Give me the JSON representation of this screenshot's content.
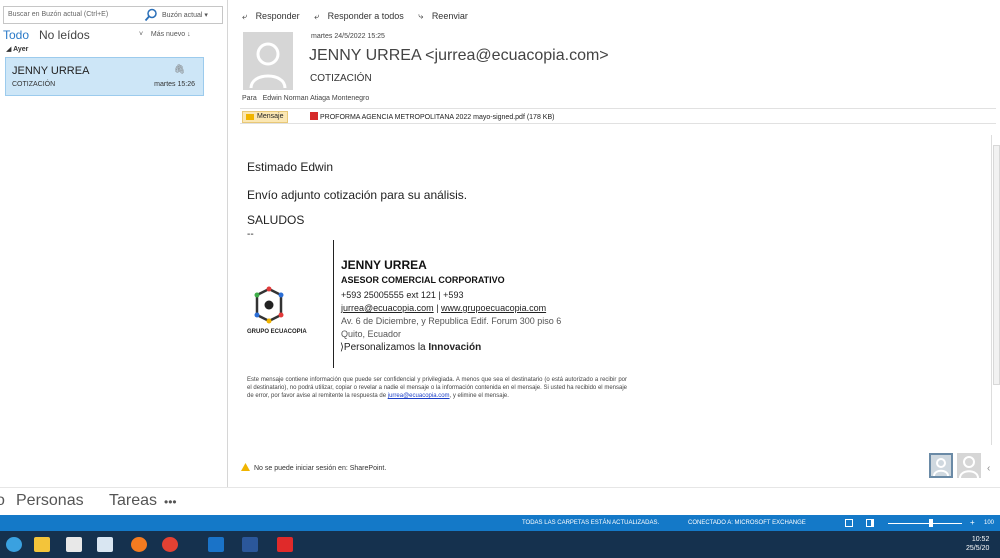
{
  "search": {
    "placeholder": "Buscar en Buzón actual (Ctrl+E)",
    "scope": "Buzón actual"
  },
  "filters": {
    "all": "Todo",
    "unread": "No leídos",
    "sort": "Más nuevo"
  },
  "list": {
    "group": "Ayer",
    "items": [
      {
        "from": "JENNY URREA",
        "subject": "COTIZACIÓN",
        "time": "martes 15:26"
      }
    ]
  },
  "actions": {
    "reply": "Responder",
    "reply_all": "Responder a todos",
    "forward": "Reenviar"
  },
  "message": {
    "date": "martes 24/5/2022 15:25",
    "from": "JENNY URREA <jurrea@ecuacopia.com>",
    "subject": "COTIZACIÓN",
    "to_label": "Para",
    "to": "Edwin Norman Atiaga Montenegro",
    "message_tab": "Mensaje",
    "attachment": "PROFORMA AGENCIA METROPOLITANA 2022 mayo-signed.pdf (178 KB)",
    "greeting": "Estimado Edwin",
    "line1": "Envío adjunto cotización para su análisis.",
    "closing": "SALUDOS",
    "dashes": "--"
  },
  "signature": {
    "name": "JENNY URREA",
    "role": "ASESOR COMERCIAL CORPORATIVO",
    "phone": "+593 25005555 ext 121 | +593",
    "email": "jurrea@ecuacopia.com",
    "sep": " | ",
    "web": "www.grupoecuacopia.com",
    "addr1": "Av. 6 de Diciembre, y Republica Edif. Forum 300 piso 6",
    "addr2": "Quito, Ecuador",
    "tag_pre": "Personalizamos la ",
    "tag_bold": "Innovación",
    "logo_text": "GRUPO ECUACOPIA"
  },
  "disclaimer": {
    "text": "Este mensaje contiene información que puede ser confidencial y privilegiada. A menos que sea el destinatario (o está autorizado a recibir por el destinatario), no podrá utilizar, copiar o revelar a nadie el mensaje o la información contenida en el mensaje. Si usted ha recibido el mensaje de error, por favor avise al remitente la respuesta de ",
    "email": "jurrea@ecuacopia.com",
    "tail": ", y elimine el mensaje."
  },
  "sharepoint": "No se puede iniciar sesión en: SharePoint.",
  "nav": {
    "people": "Personas",
    "tasks": "Tareas",
    "more": "•••",
    "partial": "o"
  },
  "status": {
    "folders": "TODAS LAS CARPETAS ESTÁN ACTUALIZADAS.",
    "connected": "CONECTADO A: MICROSOFT EXCHANGE",
    "zoom": "100"
  },
  "clock": {
    "time": "10:52",
    "date": "25/5/20"
  },
  "colors": {
    "accent": "#1479c8",
    "selected": "#cde6f7",
    "taskbar": "#15314e"
  }
}
